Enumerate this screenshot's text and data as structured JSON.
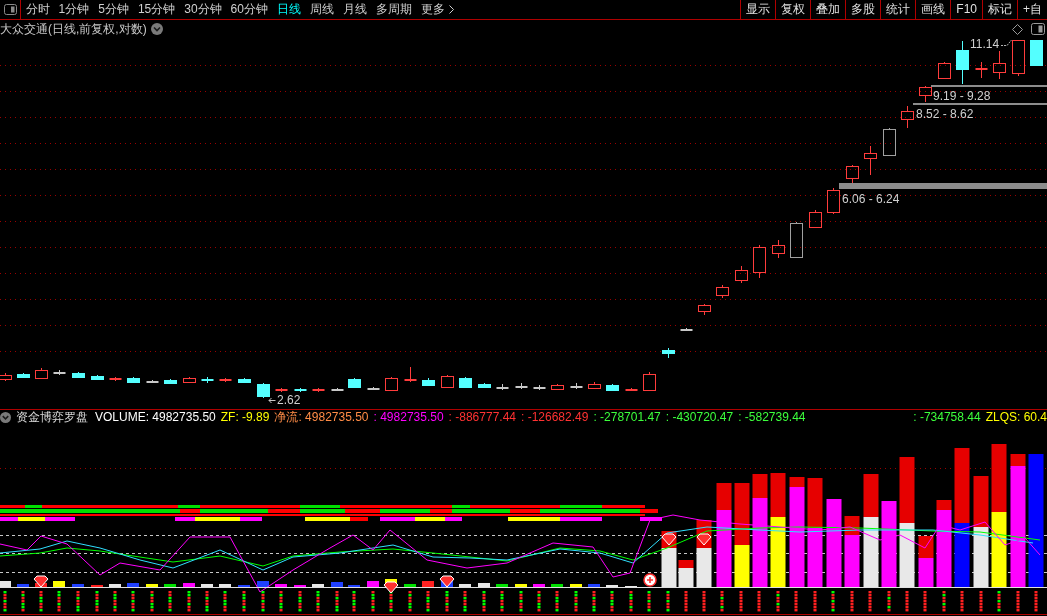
{
  "toolbar": {
    "periods": [
      {
        "label": "分时",
        "selected": false
      },
      {
        "label": "1分钟",
        "selected": false
      },
      {
        "label": "5分钟",
        "selected": false
      },
      {
        "label": "15分钟",
        "selected": false
      },
      {
        "label": "30分钟",
        "selected": false
      },
      {
        "label": "60分钟",
        "selected": false
      },
      {
        "label": "日线",
        "selected": true
      },
      {
        "label": "周线",
        "selected": false
      },
      {
        "label": "月线",
        "selected": false
      },
      {
        "label": "多周期",
        "selected": false
      }
    ],
    "more": "更多",
    "buttons": [
      "显示",
      "复权",
      "叠加",
      "多股",
      "统计",
      "画线",
      "F10",
      "标记",
      "+自"
    ]
  },
  "chart": {
    "title": "大众交通(日线,前复权,对数)",
    "high_label": "11.14",
    "low_label": "2.62",
    "gap_labels": [
      "9.19 - 9.28",
      "8.52 - 8.62",
      "6.06 - 6.24"
    ]
  },
  "indicator": {
    "title": "资金博弈罗盘",
    "values": [
      {
        "text": "VOLUME: 4982735.50",
        "color": "#ffffff"
      },
      {
        "text": "ZF: -9.89",
        "color": "#ffff00"
      },
      {
        "text": "净流: 4982735.50",
        "color": "#ff8c46"
      },
      {
        "text": ": 4982735.50",
        "color": "#ff00ff"
      },
      {
        "text": ": -886777.44",
        "color": "#ff3232"
      },
      {
        "text": ": -126682.49",
        "color": "#ff3232"
      },
      {
        "text": ": -278701.47",
        "color": "#3cff3c"
      },
      {
        "text": ": -430720.47",
        "color": "#3cff3c"
      },
      {
        "text": ": -582739.44",
        "color": "#3cff3c"
      }
    ],
    "right_values": [
      {
        "text": ": -734758.44",
        "color": "#3cff3c"
      },
      {
        "text": "ZLQS: 60.4",
        "color": "#ffff00"
      }
    ]
  }
}
